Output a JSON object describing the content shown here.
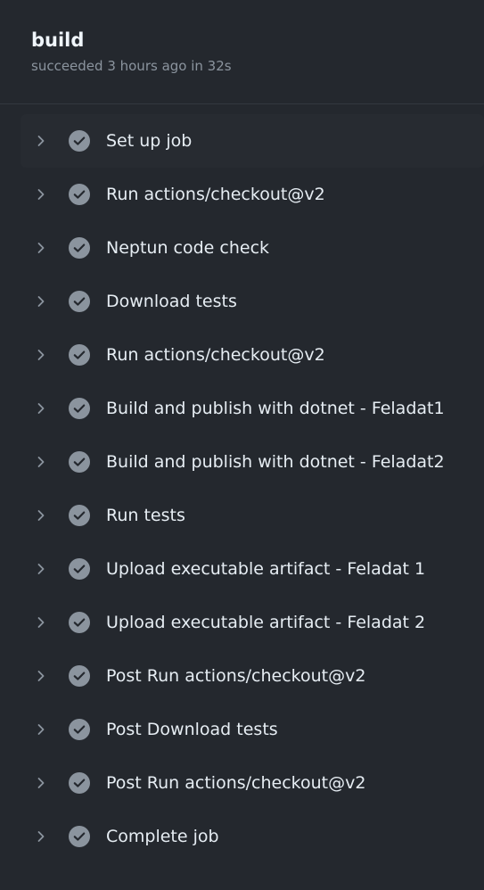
{
  "job": {
    "title": "build",
    "status": "succeeded 3 hours ago in 32s"
  },
  "colors": {
    "background": "#24282e",
    "check_icon": "#8b949e",
    "chevron_icon": "#8b949e"
  },
  "steps": [
    {
      "label": "Set up job",
      "icon": "check-circle-icon"
    },
    {
      "label": "Run actions/checkout@v2",
      "icon": "check-circle-icon"
    },
    {
      "label": "Neptun code check",
      "icon": "check-circle-icon"
    },
    {
      "label": "Download tests",
      "icon": "check-circle-icon"
    },
    {
      "label": "Run actions/checkout@v2",
      "icon": "check-circle-icon"
    },
    {
      "label": "Build and publish with dotnet - Feladat1",
      "icon": "check-circle-icon"
    },
    {
      "label": "Build and publish with dotnet - Feladat2",
      "icon": "check-circle-icon"
    },
    {
      "label": "Run tests",
      "icon": "check-circle-icon"
    },
    {
      "label": "Upload executable artifact - Feladat 1",
      "icon": "check-circle-icon"
    },
    {
      "label": "Upload executable artifact - Feladat 2",
      "icon": "check-circle-icon"
    },
    {
      "label": "Post Run actions/checkout@v2",
      "icon": "check-circle-icon"
    },
    {
      "label": "Post Download tests",
      "icon": "check-circle-icon"
    },
    {
      "label": "Post Run actions/checkout@v2",
      "icon": "check-circle-icon"
    },
    {
      "label": "Complete job",
      "icon": "check-circle-icon"
    }
  ]
}
